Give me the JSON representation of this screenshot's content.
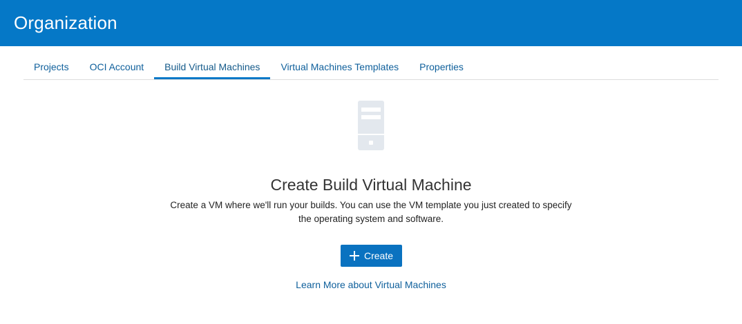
{
  "header": {
    "title": "Organization"
  },
  "tabs": [
    {
      "label": "Projects"
    },
    {
      "label": "OCI Account"
    },
    {
      "label": "Build Virtual Machines",
      "active": true
    },
    {
      "label": "Virtual Machines Templates"
    },
    {
      "label": "Properties"
    }
  ],
  "empty_state": {
    "icon": "server-icon",
    "title": "Create Build Virtual Machine",
    "description": "Create a VM where we'll run your builds. You can use the VM template you just created to specify the operating system and software.",
    "create_label": "Create",
    "create_icon": "plus-icon",
    "learn_more_label": "Learn More about Virtual Machines"
  },
  "colors": {
    "header": "#0578c7",
    "accent": "#0578c7",
    "link": "#0e5f9b",
    "icon_fill": "#e3e8ee"
  }
}
